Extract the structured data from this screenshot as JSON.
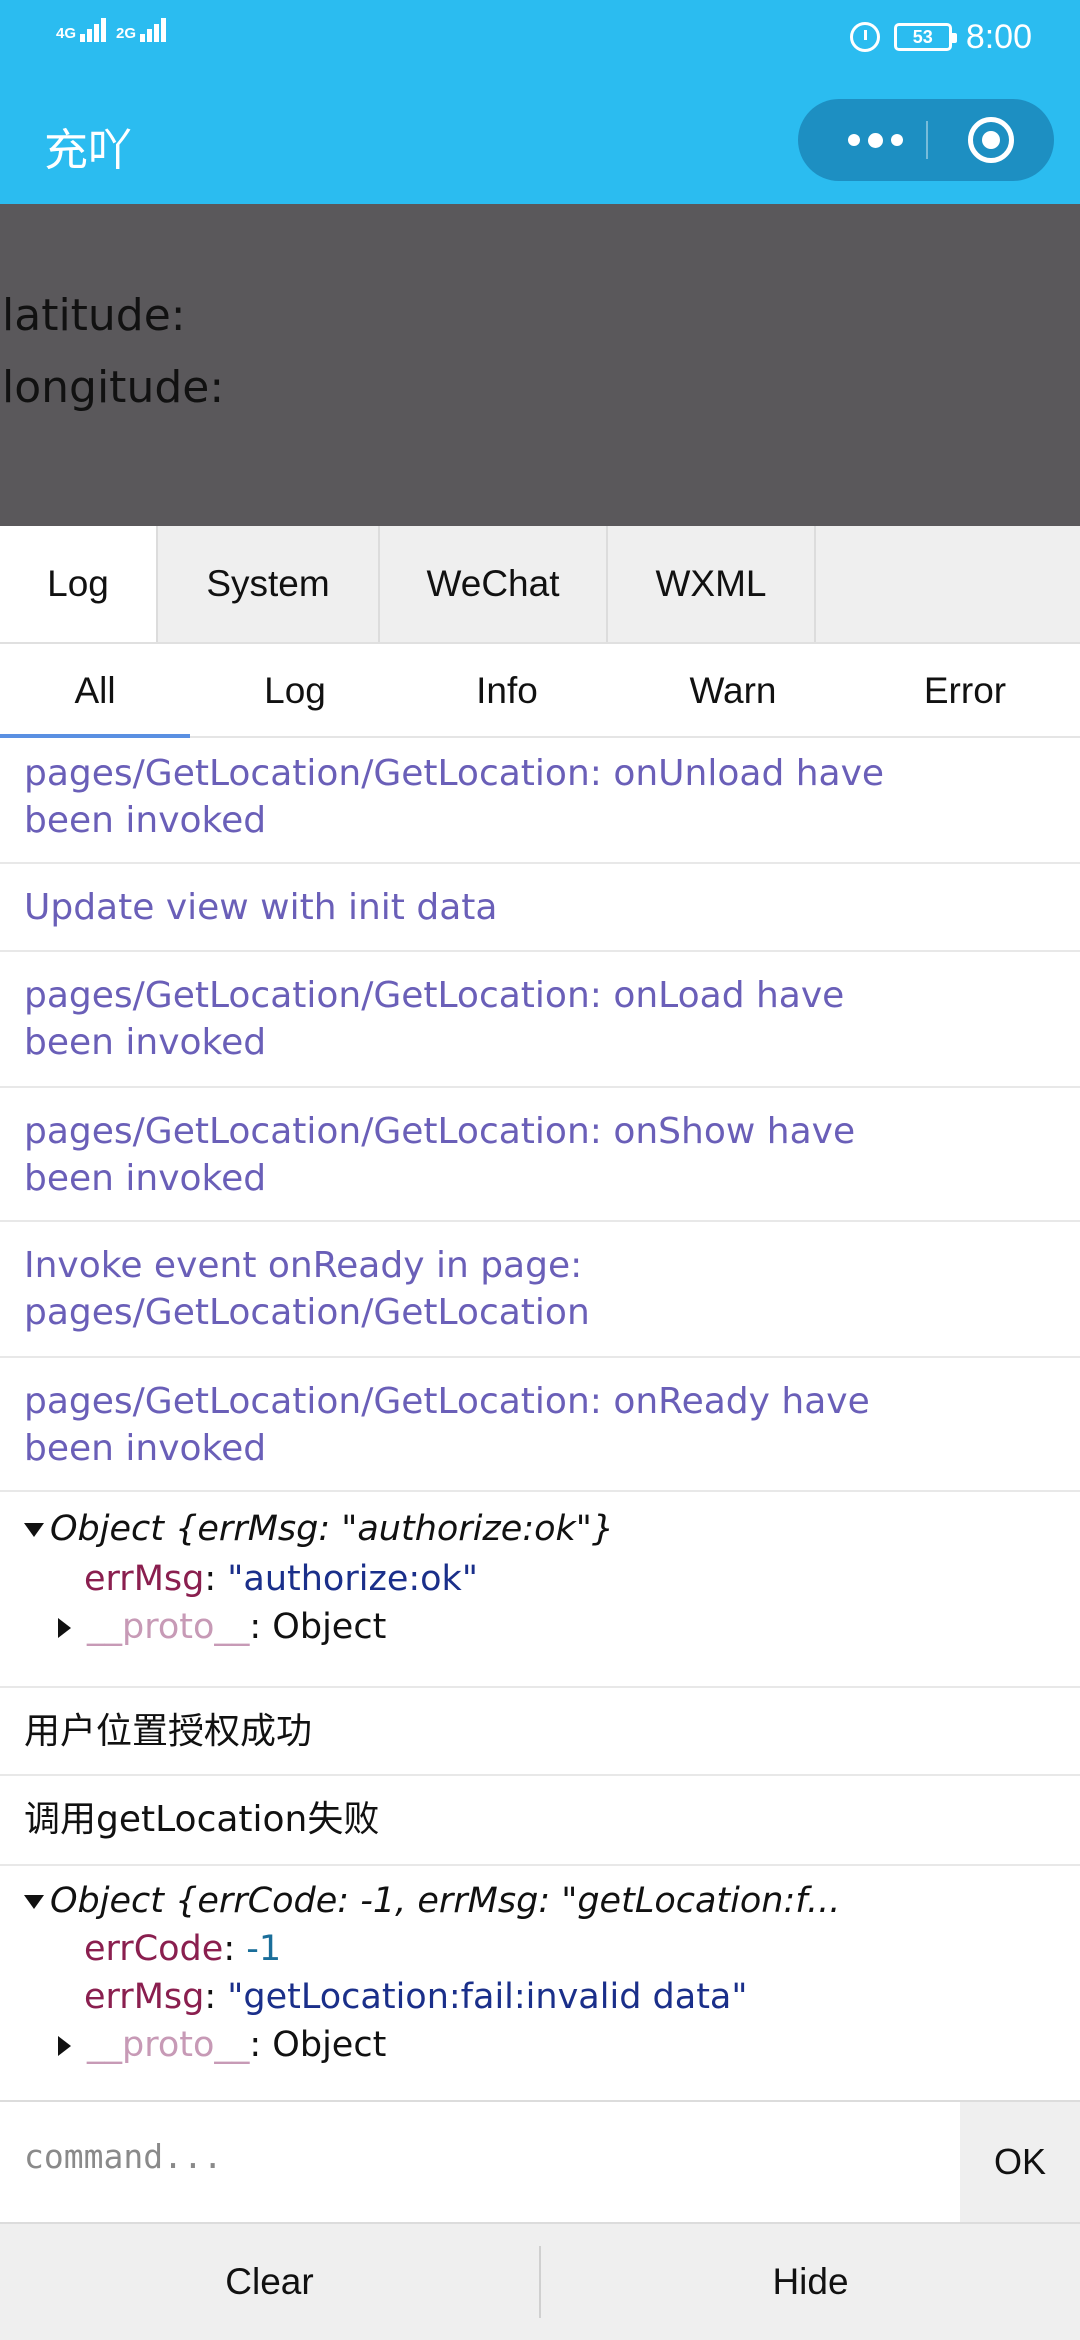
{
  "status_bar": {
    "signal_1": "4G",
    "signal_2": "2G",
    "battery": "53",
    "time": "8:00"
  },
  "nav": {
    "title": "充吖"
  },
  "page": {
    "latitude_label": "latitude:",
    "longitude_label": "longitude:"
  },
  "panel_tabs": [
    "Log",
    "System",
    "WeChat",
    "WXML"
  ],
  "filter_tabs": [
    "All",
    "Log",
    "Info",
    "Warn",
    "Error"
  ],
  "logs": {
    "l1a": "pages/GetLocation/GetLocation: onUnload have",
    "l1b": "been invoked",
    "l2": "Update view with init data",
    "l3a": "pages/GetLocation/GetLocation: onLoad have",
    "l3b": "been invoked",
    "l4a": "pages/GetLocation/GetLocation: onShow have",
    "l4b": "been invoked",
    "l5a": "Invoke event onReady in page:",
    "l5b": "pages/GetLocation/GetLocation",
    "l6a": "pages/GetLocation/GetLocation: onReady have",
    "l6b": "been invoked",
    "obj1": {
      "summary": "Object {errMsg: \"authorize:ok\"}",
      "k1": "errMsg",
      "v1": "\"authorize:ok\"",
      "proto": "__proto__",
      "proto_val": ": Object"
    },
    "l7": "用户位置授权成功",
    "l8": "调用getLocation失败",
    "obj2": {
      "summary": "Object {errCode: -1, errMsg: \"getLocation:f...",
      "k1": "errCode",
      "v1": "-1",
      "k2": "errMsg",
      "v2": "\"getLocation:fail:invalid data\"",
      "proto": "__proto__",
      "proto_val": ": Object"
    }
  },
  "command": {
    "placeholder": "command...",
    "ok_label": "OK"
  },
  "bottom": {
    "clear_label": "Clear",
    "hide_label": "Hide"
  }
}
